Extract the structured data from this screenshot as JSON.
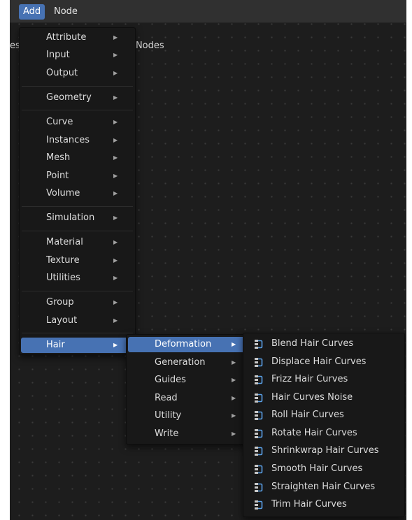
{
  "topbar": {
    "add_label": "Add",
    "node_label": "Node"
  },
  "breadcrumb": {
    "prefix": "es",
    "item": "Geometry Nodes"
  },
  "add_menu": {
    "items": [
      {
        "label": "Attribute"
      },
      {
        "label": "Input"
      },
      {
        "label": "Output"
      },
      {
        "label": "Geometry"
      },
      {
        "label": "Curve"
      },
      {
        "label": "Instances"
      },
      {
        "label": "Mesh"
      },
      {
        "label": "Point"
      },
      {
        "label": "Volume"
      },
      {
        "label": "Simulation"
      },
      {
        "label": "Material"
      },
      {
        "label": "Texture"
      },
      {
        "label": "Utilities"
      },
      {
        "label": "Group"
      },
      {
        "label": "Layout"
      },
      {
        "label": "Hair"
      }
    ],
    "highlighted": "Hair"
  },
  "hair_menu": {
    "items": [
      {
        "label": "Deformation"
      },
      {
        "label": "Generation"
      },
      {
        "label": "Guides"
      },
      {
        "label": "Read"
      },
      {
        "label": "Utility"
      },
      {
        "label": "Write"
      }
    ],
    "highlighted": "Deformation"
  },
  "deformation_menu": {
    "items": [
      {
        "label": "Blend Hair Curves"
      },
      {
        "label": "Displace Hair Curves"
      },
      {
        "label": "Frizz Hair Curves"
      },
      {
        "label": "Hair Curves Noise"
      },
      {
        "label": "Roll Hair Curves"
      },
      {
        "label": "Rotate Hair Curves"
      },
      {
        "label": "Shrinkwrap Hair Curves"
      },
      {
        "label": "Smooth Hair Curves"
      },
      {
        "label": "Straighten Hair Curves"
      },
      {
        "label": "Trim Hair Curves"
      }
    ],
    "icon": "node-group-icon"
  },
  "colors": {
    "accent": "#4772b3",
    "menu_bg": "#181818",
    "editor_bg": "#1d1d1d"
  }
}
